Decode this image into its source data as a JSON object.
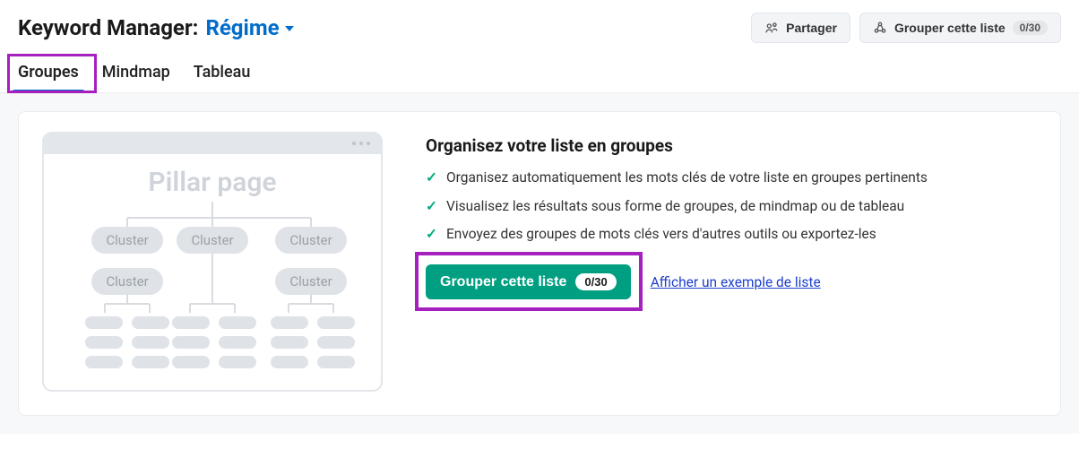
{
  "header": {
    "title_prefix": "Keyword Manager:",
    "list_name": "Régime",
    "share_label": "Partager",
    "group_label": "Grouper cette liste",
    "group_count": "0/30"
  },
  "tabs": {
    "groupes": "Groupes",
    "mindmap": "Mindmap",
    "tableau": "Tableau"
  },
  "illustration": {
    "pillar_label": "Pillar page",
    "cluster_label": "Cluster"
  },
  "panel": {
    "heading": "Organisez votre liste en groupes",
    "bullets": [
      "Organisez automatiquement les mots clés de votre liste en groupes pertinents",
      "Visualisez les résultats sous forme de groupes, de mindmap ou de tableau",
      "Envoyez des groupes de mots clés vers d'autres outils ou exportez-les"
    ],
    "cta_label": "Grouper cette liste",
    "cta_count": "0/30",
    "example_link": "Afficher un exemple de liste"
  }
}
